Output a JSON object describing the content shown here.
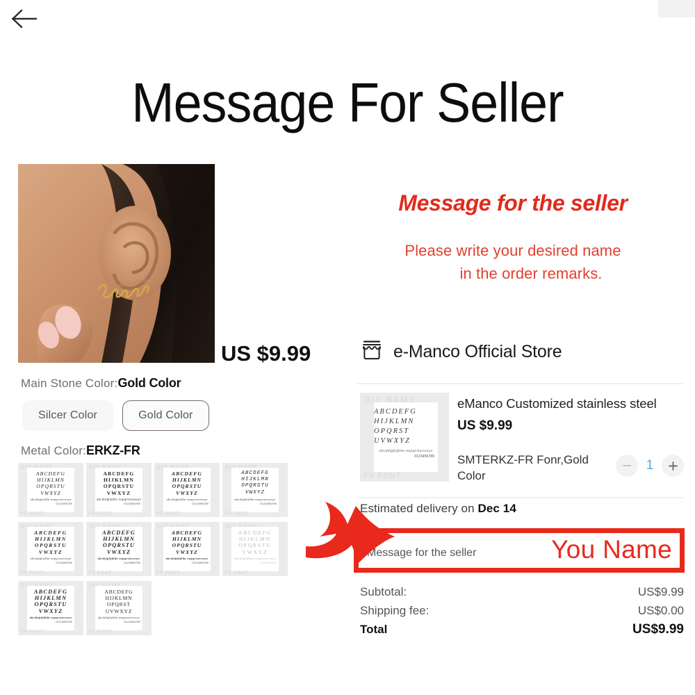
{
  "header": {
    "back_icon": "back-arrow-icon",
    "banner_title": "Message For Seller"
  },
  "left": {
    "product_photo_alt": "woman ear wearing gold custom name earring",
    "price": "US $9.99",
    "main_stone": {
      "label": "Main Stone Color:",
      "value": "Gold Color"
    },
    "color_options": [
      {
        "label": "Silcer Color",
        "selected": false
      },
      {
        "label": "Gold Color",
        "selected": true
      }
    ],
    "metal": {
      "label": "Metal Color:",
      "value": "ERKZ-FR"
    },
    "font_swatches": [
      {
        "id": "swatch-1",
        "diy": "DIY NAME",
        "fr": "FR FONT",
        "upper": "ABCDEFG HIJKLMN OPQRSTU VWXYZ",
        "lower": "abcdefghijklm nopqrstuvwxyz",
        "digits": "0123456789"
      },
      {
        "id": "swatch-2",
        "diy": "DIY NAME",
        "fr": "FR FONT",
        "upper": "ABCDEFG HIJKLMN OPQRSTU VWXYZ",
        "lower": "abcdefghijklm nopqrstuvwxyz",
        "digits": "0123456789"
      },
      {
        "id": "swatch-3",
        "diy": "DIY NAME",
        "fr": "FR FONT",
        "upper": "ABCDEFG HIJKLMN OPQRSTU VWXYZ",
        "lower": "abcdefghijklm nopqrstuvwxyz",
        "digits": "0123456789"
      },
      {
        "id": "swatch-4",
        "diy": "DIY NAME",
        "fr": "FR FONT",
        "upper": "ABCDEFG HIJKLMN OPQRSTU VWXYZ",
        "lower": "abcdefghijklm nopqrstuvwxyz",
        "digits": "0123456789"
      },
      {
        "id": "swatch-5",
        "diy": "DIY NAME",
        "fr": "FR FONT",
        "upper": "ABCDEFG HIJKLMN OPQRSTU VWXYZ",
        "lower": "abcdefghijklm nopqrstuvwxyz",
        "digits": "0123456789"
      },
      {
        "id": "swatch-6",
        "diy": "DIY NAME",
        "fr": "FR FONT",
        "upper": "ABCDEFG HIJKLMN OPQRSTU VWXYZ",
        "lower": "abcdefghijklm nopqrstuvwxyz",
        "digits": "0123456789"
      },
      {
        "id": "swatch-7",
        "diy": "DIY NAME",
        "fr": "FR FONT",
        "upper": "ABCDEFG HIJKLMN OPQRSTU VWXYZ",
        "lower": "abcdefghijklm nopqrstuvwxyz",
        "digits": "0123456789"
      },
      {
        "id": "swatch-8",
        "diy": "DIY NAME",
        "fr": "FR FONT",
        "upper": "ABCDEFG HIJKLMN OPQRSTU VWXYZ",
        "lower": "abcdefghijklm nopqrstuvwxyz",
        "digits": "0123456789"
      },
      {
        "id": "swatch-9",
        "diy": "DIY NAME",
        "fr": "FR FONT",
        "upper": "ABCDEFG HIJKLMN OPQRSTU VWXYZ",
        "lower": "abcdefghijklm nopqrstuvwxyz",
        "digits": "0123456789"
      },
      {
        "id": "swatch-10",
        "diy": "DIY NAME",
        "fr": "FR FONT",
        "upper": "ABCDEFG HIJKLMN OPQRST UVWXYZ",
        "lower": "abcdefghijklm nopqrstuvwxyz",
        "digits": "0123456789"
      }
    ]
  },
  "right": {
    "callout_title": "Message for the seller",
    "callout_line1": "Please write your desired name",
    "callout_line2": "in the order remarks.",
    "store": {
      "icon": "store-icon",
      "name": "e-Manco Official Store"
    },
    "product": {
      "thumb_diy": "DIY NAME",
      "thumb_fr": "FR FONT",
      "thumb_upper": "ABCDEFG HIJKLMN OPQRST UVWXYZ",
      "thumb_lower": "abcdefghijklm nopqrstuvwxyz",
      "thumb_digits": "0123456789",
      "title": "eManco Customized stainless steel",
      "price": "US $9.99",
      "variant": "SMTERKZ-FR Fonr,Gold Color",
      "qty_minus": "minus-icon",
      "qty_value": "1",
      "qty_plus": "plus-icon"
    },
    "delivery_prefix": "Estimated delivery on ",
    "delivery_date": "Dec  14",
    "message_box": {
      "label": "Message for the seller",
      "value": "You Name"
    },
    "totals": [
      {
        "label": "Subtotal:",
        "value": "US$9.99",
        "bold": false
      },
      {
        "label": "Shipping fee:",
        "value": "US$0.00",
        "bold": false
      },
      {
        "label": "Total",
        "value": "US$9.99",
        "bold": true
      }
    ]
  },
  "colors": {
    "red": "#e8291b",
    "red_text": "#e0412f",
    "qty_blue": "#4fa8dd",
    "gray_bg": "#ebebeb"
  }
}
